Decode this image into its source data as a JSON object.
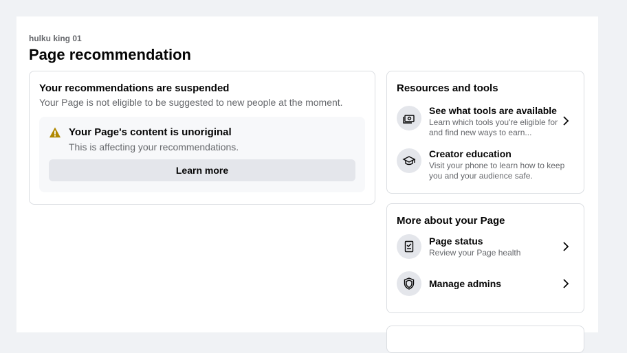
{
  "header": {
    "owner": "hulku king 01",
    "title": "Page recommendation"
  },
  "status_card": {
    "heading": "Your recommendations are suspended",
    "subtext": "Your Page is not eligible to be suggested to new people at the moment.",
    "warning": {
      "icon": "warning-icon",
      "title": "Your Page's content is unoriginal",
      "subtext": "This is affecting your recommendations.",
      "button_label": "Learn more"
    }
  },
  "resources": {
    "heading": "Resources and tools",
    "items": [
      {
        "icon": "money-icon",
        "title": "See what tools are available",
        "subtext": "Learn which tools you're eligible for and find new ways to earn..."
      },
      {
        "icon": "graduation-cap-icon",
        "title": "Creator education",
        "subtext": "Visit your phone to learn how to keep you and your audience safe."
      }
    ]
  },
  "more_about": {
    "heading": "More about your Page",
    "items": [
      {
        "icon": "checklist-icon",
        "title": "Page status",
        "subtext": "Review your Page health"
      },
      {
        "icon": "shield-icon",
        "title": "Manage admins"
      }
    ]
  },
  "colors": {
    "background": "#f0f2f5",
    "card_border": "#dadde1",
    "secondary_text": "#65676b",
    "button_bg": "#e4e6eb",
    "warning": "#b08800"
  }
}
